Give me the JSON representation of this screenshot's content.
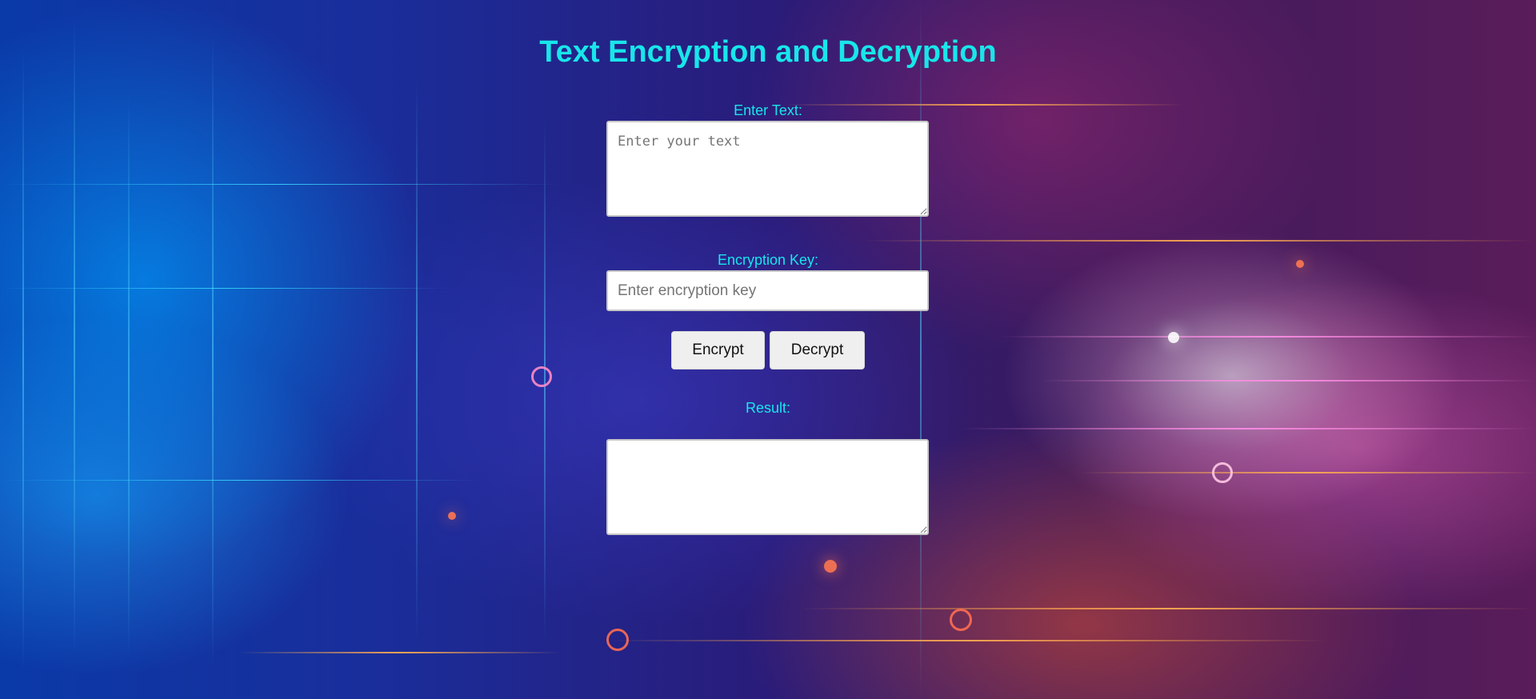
{
  "page": {
    "title": "Text Encryption and Decryption",
    "accent_color": "#18e6ea"
  },
  "input_section": {
    "label": "Enter Text:",
    "placeholder": "Enter your text",
    "value": ""
  },
  "key_section": {
    "label": "Encryption Key:",
    "placeholder": "Enter encryption key",
    "value": ""
  },
  "actions": {
    "encrypt_label": "Encrypt",
    "decrypt_label": "Decrypt"
  },
  "result_section": {
    "label": "Result:",
    "value": ""
  }
}
